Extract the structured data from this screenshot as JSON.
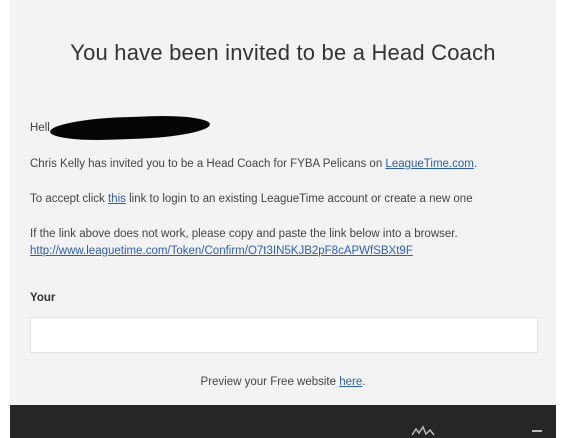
{
  "email": {
    "title": "You have been invited to be a Head Coach",
    "greeting_prefix": "Hell",
    "invite_text": "Chris Kelly has invited you to be a Head Coach for FYBA Pelicans on ",
    "invite_link": "LeagueTime.com",
    "invite_suffix": ".",
    "accept_prefix": "To accept click ",
    "accept_link": "this",
    "accept_suffix": " link to login to an existing LeagueTime account or create a new one",
    "fallback_text": "If the link above does not work, please copy and paste the link below into a browser.",
    "token_link": "http://www.leaguetime.com/Token/Confirm/O7t3IN5KJB2pF8cAPWfSBXt9F",
    "your_label": "Your",
    "your_input_value": "",
    "preview_prefix": "Preview your Free website ",
    "preview_link": "here",
    "preview_suffix": "."
  },
  "colors": {
    "background": "#f3f3f3",
    "link": "#2a5fb5",
    "footer": "#262626"
  }
}
